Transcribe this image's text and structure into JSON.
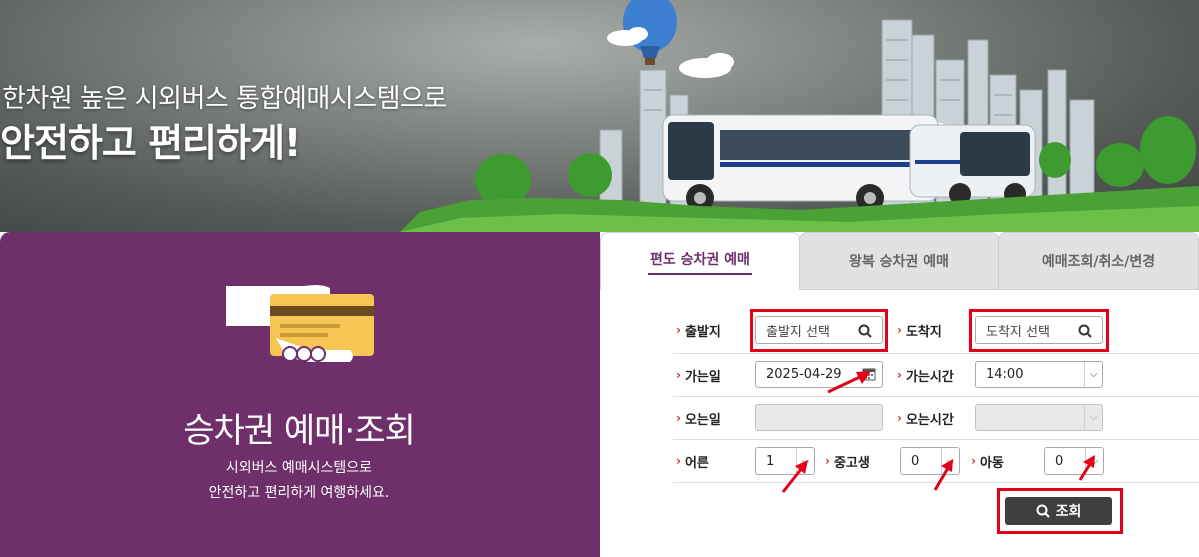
{
  "hero": {
    "line1": "한차원 높은 시외버스 통합예매시스템으로",
    "line2": "안전하고 편리하게!"
  },
  "promo": {
    "title": "승차권 예매·조회",
    "desc_line1": "시외버스 예매시스템으로",
    "desc_line2": "안전하고 편리하게 여행하세요."
  },
  "tabs": [
    {
      "label": "편도 승차권 예매",
      "active": true
    },
    {
      "label": "왕복 승차권 예매",
      "active": false
    },
    {
      "label": "예매조회/취소/변경",
      "active": false
    }
  ],
  "form": {
    "departure": {
      "label": "출발지",
      "placeholder": "출발지 선택"
    },
    "arrival": {
      "label": "도착지",
      "placeholder": "도착지 선택"
    },
    "go_date": {
      "label": "가는일",
      "value": "2025-04-29"
    },
    "go_time": {
      "label": "가는시간",
      "value": "14:00"
    },
    "return_date": {
      "label": "오는일",
      "value": ""
    },
    "return_time": {
      "label": "오는시간",
      "value": ""
    },
    "adult": {
      "label": "어른",
      "value": "1"
    },
    "student": {
      "label": "중고생",
      "value": "0"
    },
    "child": {
      "label": "아동",
      "value": "0"
    },
    "search_button": "조회"
  },
  "colors": {
    "brand_purple": "#6e2f6b",
    "highlight_red": "#e4001b",
    "button_dark": "#3f3f3f"
  },
  "icons": [
    "search-icon",
    "calendar-icon",
    "chevron-down-icon",
    "hand-card-icon",
    "red-arrow-annotation"
  ]
}
